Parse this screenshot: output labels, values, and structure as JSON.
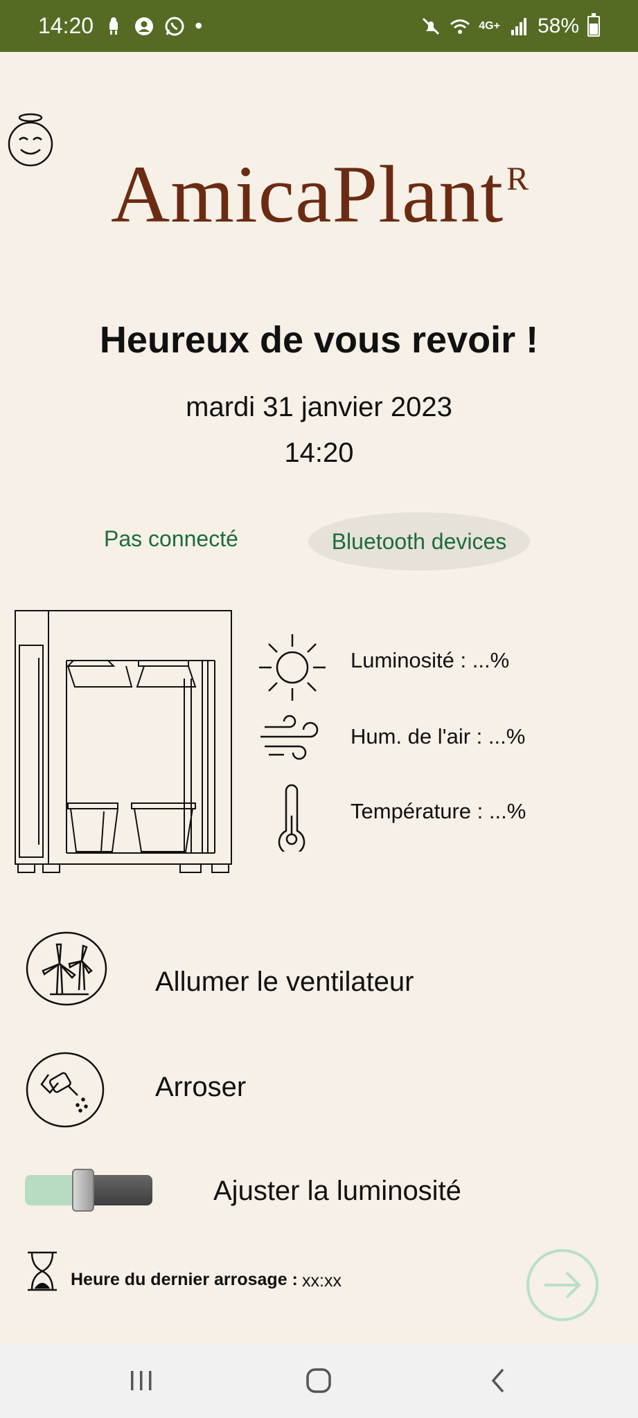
{
  "status_bar": {
    "time": "14:20",
    "dot": "•",
    "battery_percent": "58%",
    "network": "4G+",
    "icons_left": [
      "android-icon",
      "account-icon",
      "whatsapp-icon"
    ],
    "icons_right": [
      "mute-icon",
      "wifi-icon",
      "network-icon",
      "signal-icon",
      "battery-icon"
    ]
  },
  "app": {
    "logo": "AmicaPlant",
    "logo_mark": "R",
    "welcome": "Heureux de vous revoir !",
    "date": "mardi 31 janvier 2023",
    "time": "14:20"
  },
  "connection": {
    "status": "Pas connecté",
    "bluetooth_button": "Bluetooth devices"
  },
  "sensors": {
    "luminosity": "Luminosité :  ...%",
    "humidity": "Hum. de l'air : ...%",
    "temperature": "Température :  ...%"
  },
  "actions": {
    "fan": "Allumer le ventilateur",
    "water": "Arroser",
    "brightness": "Ajuster la luminosité",
    "brightness_level": 0.45
  },
  "last_watering": {
    "label": "Heure du dernier arrosage :",
    "value": "xx:xx"
  },
  "colors": {
    "status_bar": "#556b24",
    "background": "#f6f0e7",
    "logo": "#6b2b12",
    "accent_green": "#1d6b3b",
    "slider_fill": "#b7dcc2",
    "next_button": "#b9e0c6"
  }
}
